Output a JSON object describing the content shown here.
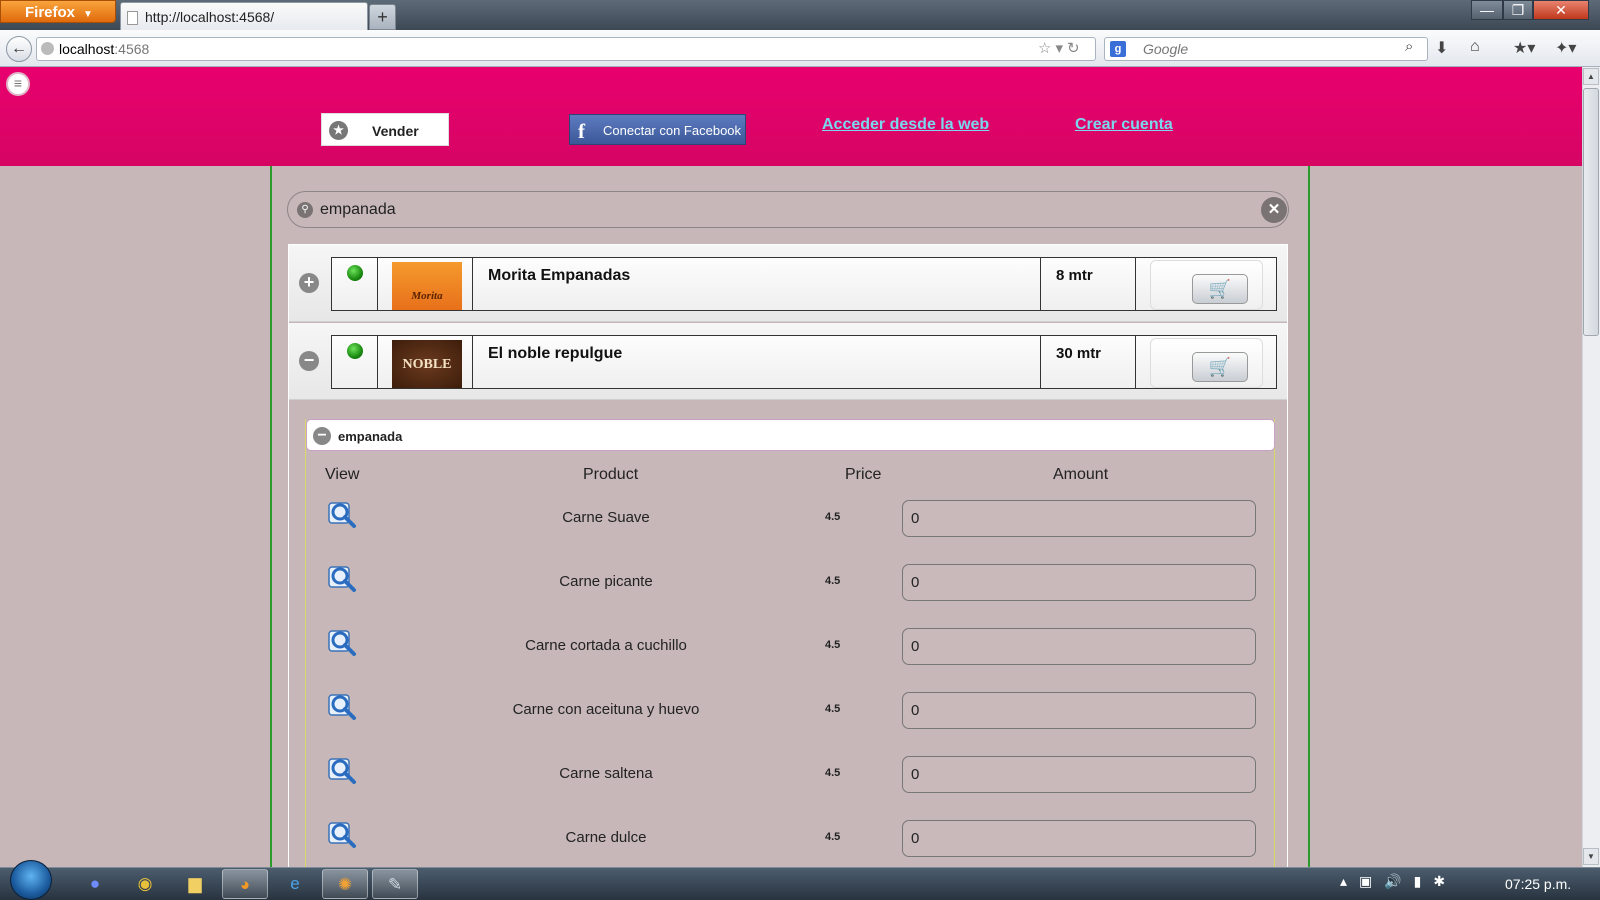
{
  "browser": {
    "app_button": "Firefox",
    "tab_title": "http://localhost:4568/",
    "new_tab": "+",
    "url_host": "localhost",
    "url_port": ":4568",
    "search_placeholder": "Google",
    "window_buttons": {
      "minimize": "—",
      "maximize": "❐",
      "close": "✕"
    }
  },
  "header": {
    "sell_button": "Vender",
    "facebook_button": "Conectar con Facebook",
    "web_login_link": "Acceder desde la web",
    "create_account_link": "Crear cuenta"
  },
  "search": {
    "value": "empanada"
  },
  "shops": [
    {
      "name": "Morita Empanadas",
      "distance": "8 mtr",
      "status_color": "#1a9a12",
      "expanded": false,
      "logo_text": "Morita"
    },
    {
      "name": "El noble repulgue",
      "distance": "30 mtr",
      "status_color": "#1a9a12",
      "expanded": true,
      "logo_text": "NOBLE"
    }
  ],
  "category": {
    "title": "empanada",
    "columns": {
      "view": "View",
      "product": "Product",
      "price": "Price",
      "amount": "Amount"
    },
    "products": [
      {
        "name": "Carne Suave",
        "price": "4.5",
        "amount": "0"
      },
      {
        "name": "Carne picante",
        "price": "4.5",
        "amount": "0"
      },
      {
        "name": "Carne cortada a cuchillo",
        "price": "4.5",
        "amount": "0"
      },
      {
        "name": "Carne con aceituna y huevo",
        "price": "4.5",
        "amount": "0"
      },
      {
        "name": "Carne saltena",
        "price": "4.5",
        "amount": "0"
      },
      {
        "name": "Carne dulce",
        "price": "4.5",
        "amount": "0"
      }
    ]
  },
  "taskbar": {
    "clock": "07:25 p.m."
  },
  "colors": {
    "header_pink": "#e8006e",
    "link": "#7ad7ee",
    "border_green": "#2a9a2a",
    "page_bg": "#c7b7b9"
  }
}
